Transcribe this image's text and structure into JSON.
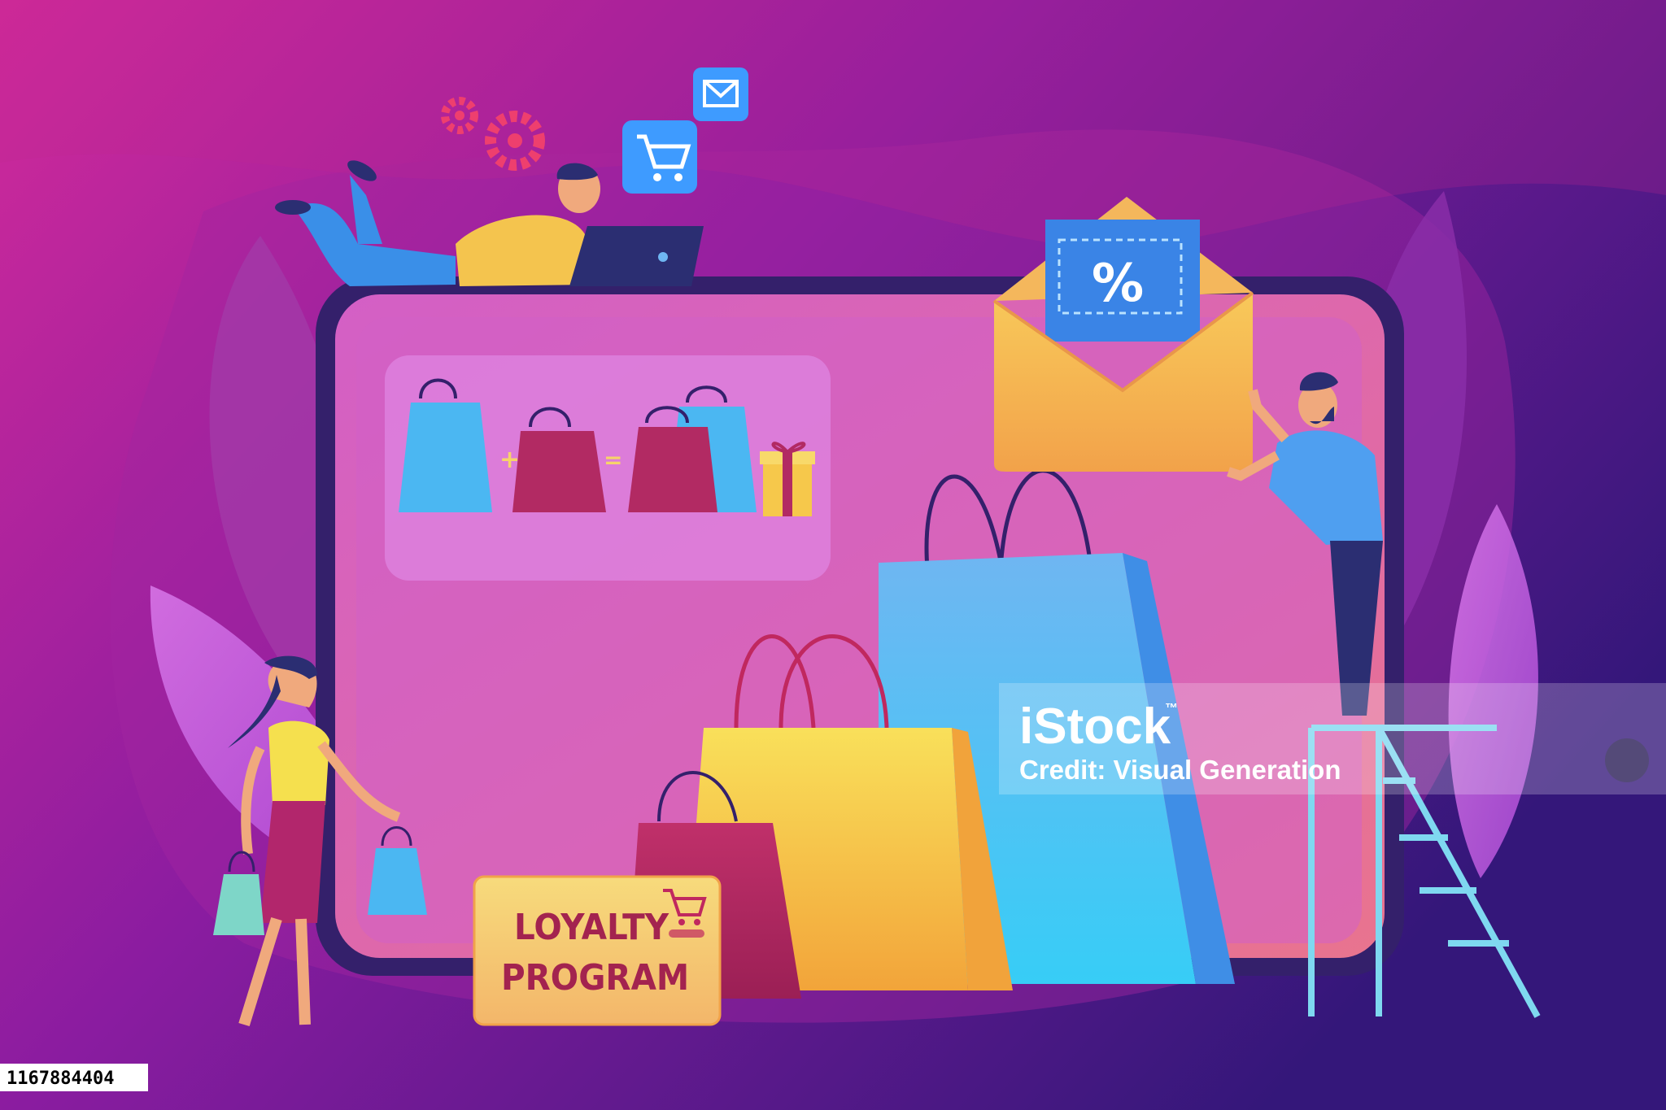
{
  "illustration": {
    "loyalty_card": {
      "line1": "LOYALTY",
      "line2": "PROGRAM"
    },
    "coupon": {
      "symbol": "%"
    },
    "equation": {
      "plus": "+",
      "equals": "="
    }
  },
  "watermark": {
    "brand": "iStock",
    "trademark": "™",
    "credit": "Credit: Visual Generation"
  },
  "image_id": "1167884404",
  "colors": {
    "background_left": "#d12a9a",
    "background_right": "#3a1a7a",
    "tablet_screen": "#d95cc0",
    "bag_blue": "#4fc6f0",
    "bag_yellow": "#f5c842",
    "bag_crimson": "#b12a62",
    "app_icon_blue": "#3e9bff",
    "card_yellow": "#f7d774"
  }
}
